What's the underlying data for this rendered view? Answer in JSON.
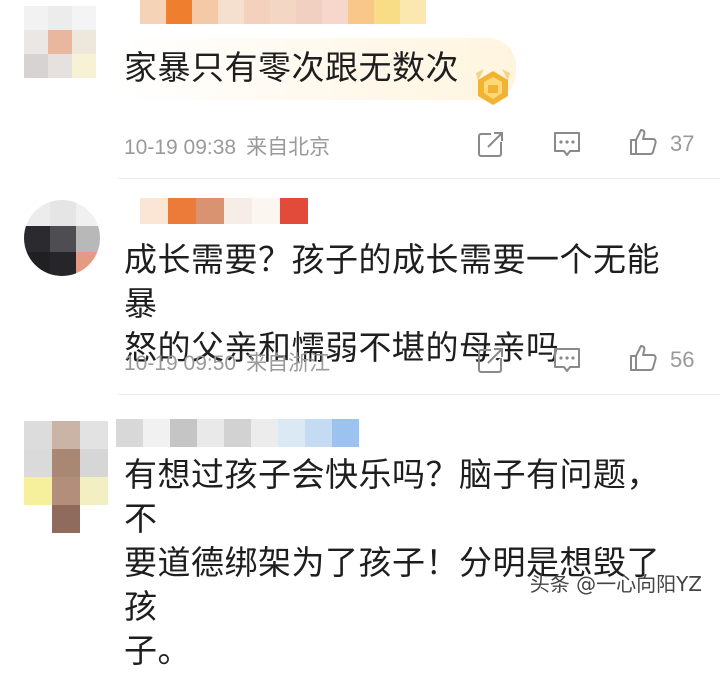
{
  "comments": [
    {
      "text_lines": [
        "家暴只有零次跟无数次"
      ],
      "time": "10-19 09:38",
      "location": "来自北京",
      "likes": "37",
      "has_badge": true,
      "icons": [
        "share-icon",
        "reply-icon",
        "like-icon"
      ]
    },
    {
      "text_lines": [
        "成长需要？孩子的成长需要一个无能暴",
        "怒的父亲和懦弱不堪的母亲吗"
      ],
      "time": "10-19 09:50",
      "location": "来自浙江",
      "likes": "56",
      "icons": [
        "share-icon",
        "reply-icon",
        "like-icon"
      ]
    },
    {
      "text_lines": [
        "有想过孩子会快乐吗？脑子有问题，不",
        "要道德绑架为了孩子！分明是想毁了孩",
        "子。"
      ]
    }
  ],
  "watermark": "头条 @一心向阳YZ",
  "colors": {
    "text": "#1e1e1e",
    "meta": "#9a9a9a",
    "icon": "#8a8a8a",
    "badge": "#f2b233"
  }
}
